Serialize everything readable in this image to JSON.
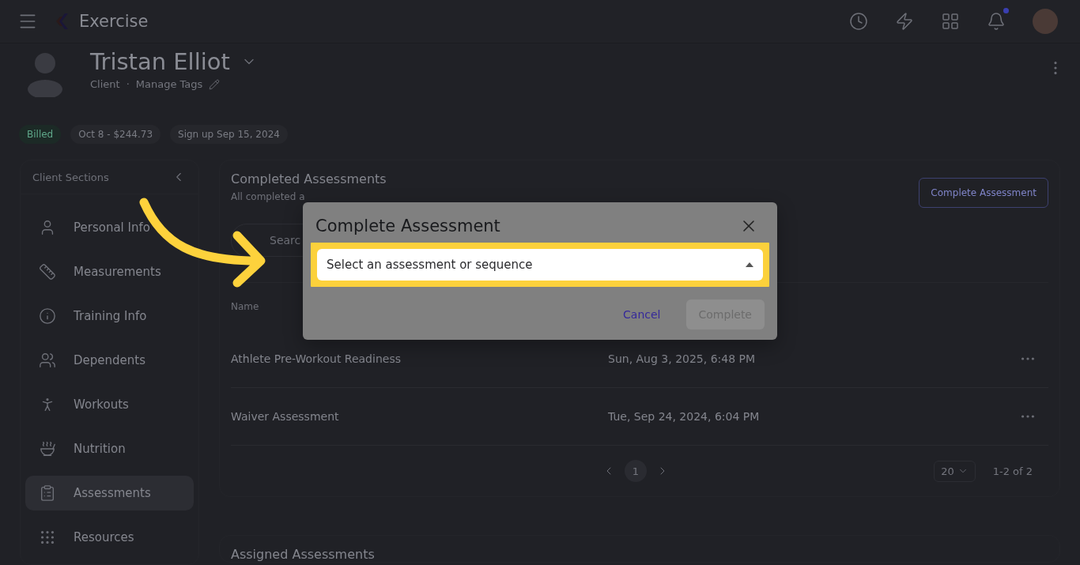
{
  "topbar": {
    "app_name": "Exercise",
    "notification_dot": true
  },
  "client": {
    "name": "Tristan Elliot",
    "role": "Client",
    "separator": "·",
    "tags_link": "Manage Tags"
  },
  "chips": [
    {
      "label": "Billed",
      "kind": "status"
    },
    {
      "label": "Oct 8 - $244.73",
      "kind": "plain"
    },
    {
      "label": "Sign up Sep 15, 2024",
      "kind": "plain"
    }
  ],
  "sidebar": {
    "title": "Client Sections",
    "items": [
      {
        "label": "Personal Info",
        "selected": false
      },
      {
        "label": "Measurements",
        "selected": false
      },
      {
        "label": "Training Info",
        "selected": false
      },
      {
        "label": "Dependents",
        "selected": false
      },
      {
        "label": "Workouts",
        "selected": false
      },
      {
        "label": "Nutrition",
        "selected": false
      },
      {
        "label": "Assessments",
        "selected": true
      },
      {
        "label": "Resources",
        "selected": false
      }
    ]
  },
  "completed": {
    "title": "Completed Assessments",
    "subtitle": "All completed a",
    "button": "Complete Assessment",
    "search_placeholder": "Searc",
    "columns": [
      "Name"
    ],
    "rows": [
      {
        "name": "Athlete Pre-Workout Readiness",
        "date": "Sun, Aug 3, 2025, 6:48 PM"
      },
      {
        "name": "Waiver Assessment",
        "date": "Tue, Sep 24, 2024, 6:04 PM"
      }
    ],
    "pagination": {
      "page": "1",
      "page_size": "20",
      "range": "1-2 of 2"
    }
  },
  "assigned": {
    "title": "Assigned Assessments"
  },
  "dialog": {
    "title": "Complete Assessment",
    "select_placeholder": "Select an assessment or sequence",
    "highlighted": true,
    "buttons": [
      {
        "label": "Cancel",
        "kind": "text",
        "disabled": false
      },
      {
        "label": "Complete",
        "kind": "filled",
        "disabled": true
      }
    ]
  }
}
